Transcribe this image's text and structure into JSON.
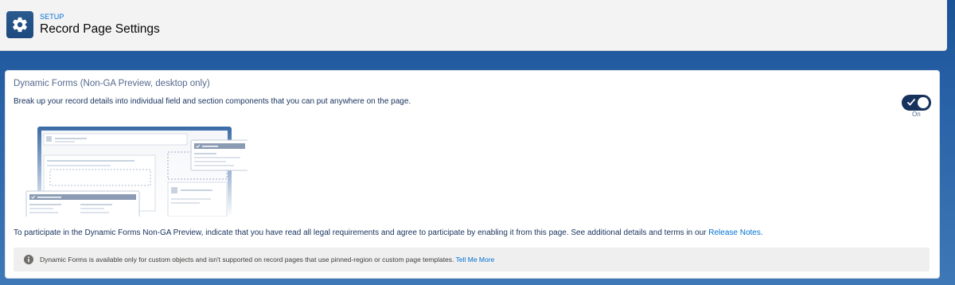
{
  "header": {
    "kicker": "SETUP",
    "title": "Record Page Settings",
    "icon": "gear-icon"
  },
  "card": {
    "title": "Dynamic Forms (Non-GA Preview, desktop only)",
    "description": "Break up your record details into individual field and section components that you can put anywhere on the page.",
    "toggle": {
      "state": true,
      "label": "On"
    },
    "participate_text": "To participate in the Dynamic Forms Non-GA Preview, indicate that you have read all legal requirements and agree to participate by enabling it from this page. See additional details and terms in our",
    "participate_link": "Release Notes.",
    "notice": {
      "icon": "info-icon",
      "text": "Dynamic Forms is available only for custom objects and isn't supported on record pages that use pinned-region or custom page templates.",
      "link": "Tell Me More"
    }
  },
  "colors": {
    "brand_blue": "#16325c",
    "link": "#0070d2",
    "background": "#1b5297"
  }
}
